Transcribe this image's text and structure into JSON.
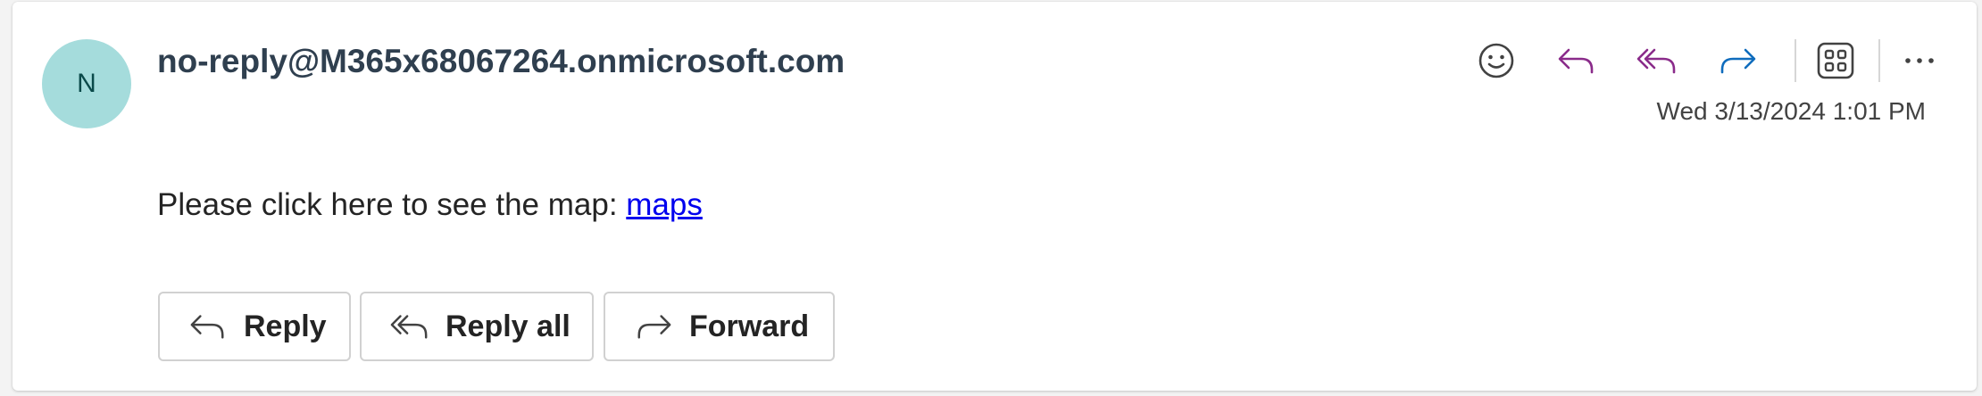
{
  "message": {
    "sender_initial": "N",
    "sender": "no-reply@M365x68067264.onmicrosoft.com",
    "timestamp": "Wed 3/13/2024 1:01 PM",
    "body_prefix": "Please click here to see the map: ",
    "body_link": "maps"
  },
  "toolbar": {
    "icons": [
      "emoji-icon",
      "reply-icon",
      "reply-all-icon",
      "forward-icon",
      "apps-icon",
      "more-icon"
    ]
  },
  "actions": {
    "reply_label": "Reply",
    "reply_all_label": "Reply all",
    "forward_label": "Forward"
  },
  "colors": {
    "avatar_bg": "#a5dcdc",
    "reply_accent": "#8a2b8a",
    "forward_accent": "#0f6cbd",
    "link": "#0000ee"
  }
}
